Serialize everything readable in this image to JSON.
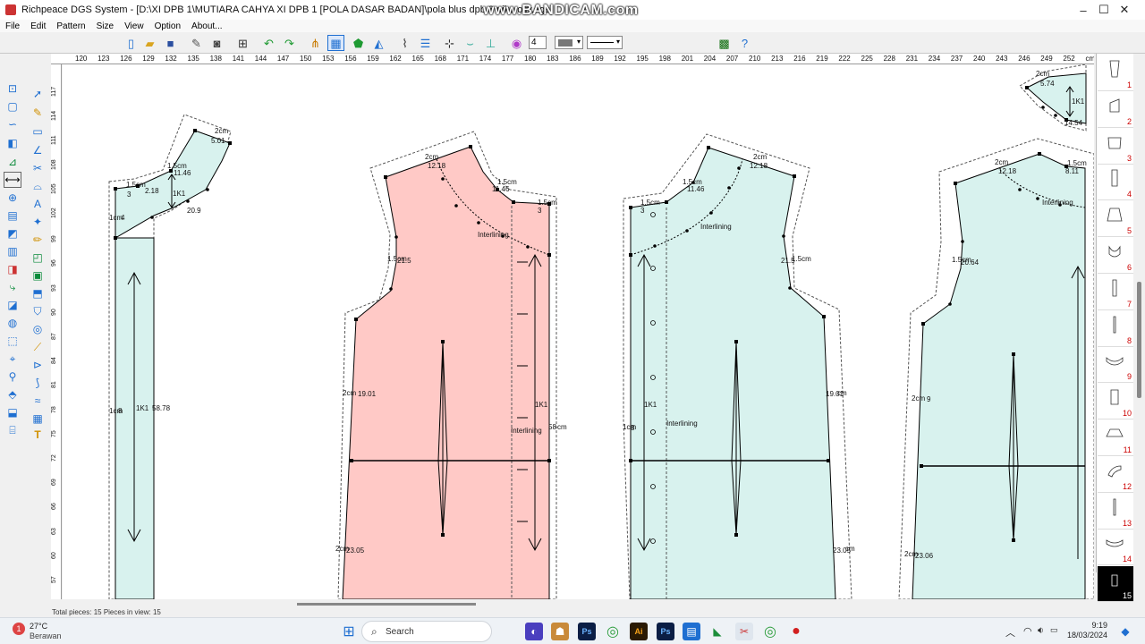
{
  "window": {
    "title": "Richpeace DGS System - [D:\\XI DPB 1\\MUTIARA CAHYA XI DPB 1 [POLA DASAR BADAN]\\pola blus dpb 3 nika oliv.dgs]",
    "watermark": "www.BANDICAM.com",
    "minimize": "–",
    "maximize": "☐",
    "close": "✕"
  },
  "menu": [
    "File",
    "Edit",
    "Pattern",
    "Size",
    "View",
    "Option",
    "About..."
  ],
  "toolbar": {
    "line_width_value": "4"
  },
  "ruler": {
    "h_ticks": [
      "120",
      "123",
      "126",
      "129",
      "132",
      "135",
      "138",
      "141",
      "144",
      "147",
      "150",
      "153",
      "156",
      "159",
      "162",
      "165",
      "168",
      "171",
      "174",
      "177",
      "180",
      "183",
      "186",
      "189",
      "192",
      "195",
      "198",
      "201",
      "204",
      "207",
      "210",
      "213",
      "216",
      "219",
      "222",
      "225",
      "228",
      "231",
      "234",
      "237",
      "240",
      "243",
      "246",
      "249",
      "252",
      "cm"
    ],
    "v_ticks": [
      "117",
      "114",
      "111",
      "108",
      "105",
      "102",
      "99",
      "96",
      "93",
      "90",
      "87",
      "84",
      "81",
      "78",
      "75",
      "72",
      "69",
      "66",
      "63",
      "60",
      "57"
    ]
  },
  "canvas_labels": {
    "p1": [
      "2cm",
      "5.01",
      "1.5cm",
      "11.46",
      "1.5cm",
      "3",
      "2.18",
      "1K1",
      "20.9",
      "1cm",
      "4",
      "1cm",
      "8",
      "1K1",
      "58.78"
    ],
    "p2": [
      "2cm",
      "12.18",
      "1.5cm",
      "11.46",
      "1.5cm",
      "3",
      "Interlining",
      "1.5cm",
      "21.5",
      "2cm",
      "19.01",
      "1K1",
      "Interlining",
      "58",
      "cm",
      "2cm",
      "23.05"
    ],
    "p3": [
      "1.5cm",
      "3",
      "1.5cm",
      "11.46",
      "2cm",
      "12.18",
      "Interlining",
      "21.5",
      "1.5cm",
      "1cm",
      "8",
      "1K1",
      "Interlining",
      "19.01",
      "cm",
      "23.05",
      "cm"
    ],
    "p4": [
      "2cm",
      "12.18",
      "1.5cm",
      "8.11",
      "Interlining",
      "1.5cm",
      "20.64",
      "2cm",
      "9",
      "2cm",
      "23.06"
    ],
    "p5": [
      "2cm",
      "5.74",
      "1K1",
      "14.54"
    ]
  },
  "pieces": [
    "1",
    "2",
    "3",
    "4",
    "5",
    "6",
    "7",
    "8",
    "9",
    "10",
    "11",
    "12",
    "13",
    "14",
    "15"
  ],
  "selected_piece": "15",
  "status": {
    "text": "Total pieces: 15   Pieces in view: 15"
  },
  "taskbar": {
    "weather_temp": "27°C",
    "weather_cond": "Berawan",
    "weather_badge": "1",
    "search_placeholder": "Search",
    "time": "9:19",
    "date": "18/03/2024"
  },
  "colors": {
    "piece_fill": "#d8f2ee",
    "piece_selected_fill": "#ffc9c6",
    "seam_line": "#000000",
    "allowance_line": "#555555"
  }
}
